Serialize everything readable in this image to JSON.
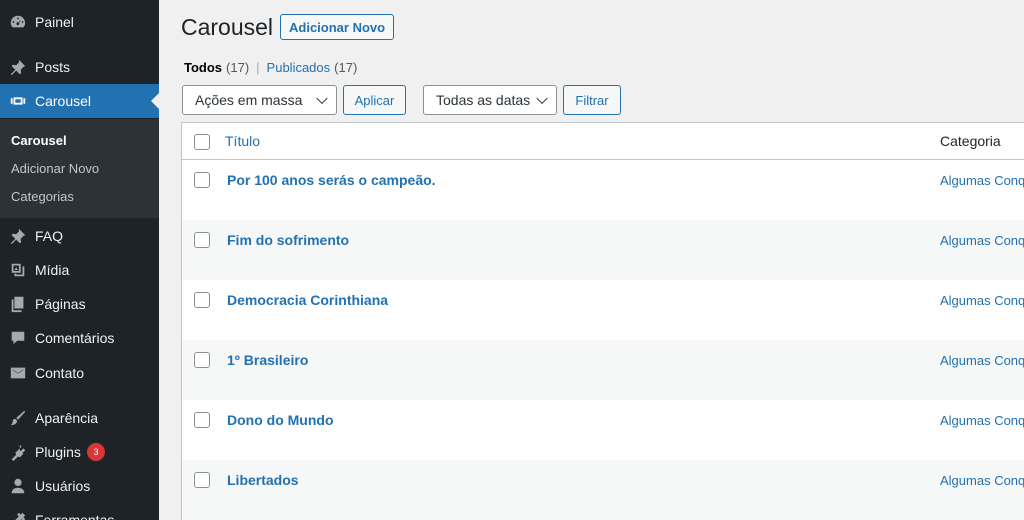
{
  "sidebar": {
    "items": [
      {
        "label": "Painel",
        "icon": "dashboard-icon"
      },
      {
        "label": "Posts",
        "icon": "pin-icon"
      },
      {
        "label": "Carousel",
        "icon": "carousel-icon"
      },
      {
        "label": "FAQ",
        "icon": "pin-icon"
      },
      {
        "label": "Mídia",
        "icon": "media-icon"
      },
      {
        "label": "Páginas",
        "icon": "pages-icon"
      },
      {
        "label": "Comentários",
        "icon": "comment-icon"
      },
      {
        "label": "Contato",
        "icon": "mail-icon"
      },
      {
        "label": "Aparência",
        "icon": "brush-icon"
      },
      {
        "label": "Plugins",
        "icon": "plugin-icon",
        "badge": "3"
      },
      {
        "label": "Usuários",
        "icon": "user-icon"
      },
      {
        "label": "Ferramentas",
        "icon": "tools-icon"
      }
    ],
    "submenu": [
      "Carousel",
      "Adicionar Novo",
      "Categorias"
    ],
    "colors": {
      "bg": "#1d2327",
      "current": "#2271b1",
      "badge": "#d63638"
    }
  },
  "header": {
    "title": "Carousel",
    "add_new": "Adicionar Novo"
  },
  "filters": {
    "all_label": "Todos",
    "all_count": "(17)",
    "separator": "|",
    "published_label": "Publicados",
    "published_count": "(17)",
    "bulk_actions": "Ações em massa",
    "apply": "Aplicar",
    "dates": "Todas as datas",
    "filter": "Filtrar"
  },
  "table": {
    "columns": {
      "title": "Título",
      "category": "Categoria"
    },
    "rows": [
      {
        "title": "Por 100 anos serás o campeão.",
        "category": "Algumas Conquistas"
      },
      {
        "title": "Fim do sofrimento",
        "category": "Algumas Conquistas"
      },
      {
        "title": "Democracia Corinthiana",
        "category": "Algumas Conquistas"
      },
      {
        "title": "1º Brasileiro",
        "category": "Algumas Conquistas"
      },
      {
        "title": "Dono do Mundo",
        "category": "Algumas Conquistas"
      },
      {
        "title": "Libertados",
        "category": "Algumas Conquistas"
      }
    ]
  }
}
